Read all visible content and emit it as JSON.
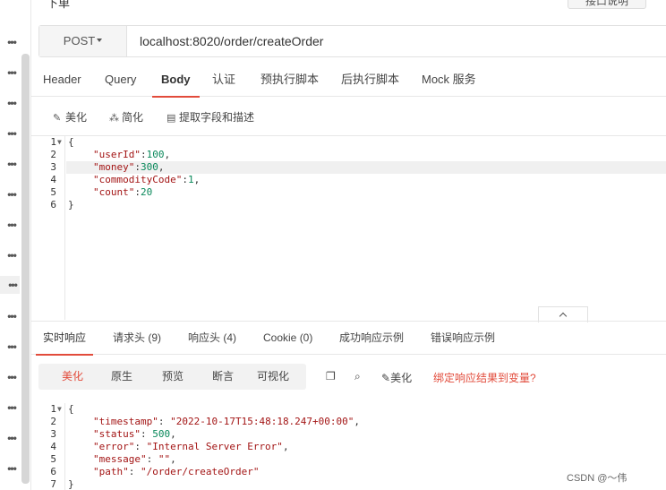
{
  "top": {
    "title": "下单",
    "doc_button": "接口说明"
  },
  "request": {
    "method": "POST",
    "url": "localhost:8020/order/createOrder",
    "tabs": [
      "Header",
      "Query",
      "Body",
      "认证",
      "预执行脚本",
      "后执行脚本",
      "Mock 服务"
    ],
    "active_tab": "Body"
  },
  "body_tools": {
    "beautify": "美化",
    "simplify": "简化",
    "extract": "提取字段和描述"
  },
  "request_body": {
    "line_numbers": [
      "1",
      "2",
      "3",
      "4",
      "5",
      "6"
    ],
    "lines": [
      "{",
      "\"userId\":100,",
      "\"money\":300,",
      "\"commodityCode\":1,",
      "\"count\":20",
      "}"
    ]
  },
  "response": {
    "tabs": [
      "实时响应",
      "请求头 (9)",
      "响应头 (4)",
      "Cookie (0)",
      "成功响应示例",
      "错误响应示例"
    ],
    "active_tab": "实时响应",
    "view_modes": [
      "美化",
      "原生",
      "预览",
      "断言",
      "可视化"
    ],
    "active_view": "美化",
    "beautify_label": "美化",
    "bind_link": "绑定响应结果到变量?",
    "line_numbers": [
      "1",
      "2",
      "3",
      "4",
      "5",
      "6",
      "7"
    ],
    "lines": [
      "{",
      "\"timestamp\": \"2022-10-17T15:48:18.247+00:00\",",
      "\"status\": 500,",
      "\"error\": \"Internal Server Error\",",
      "\"message\": \"\",",
      "\"path\": \"/order/createOrder\"",
      "}"
    ]
  },
  "watermark": "CSDN @～伟",
  "colors": {
    "accent": "#e24b3b",
    "json_key": "#a31515",
    "json_number": "#09885a"
  }
}
